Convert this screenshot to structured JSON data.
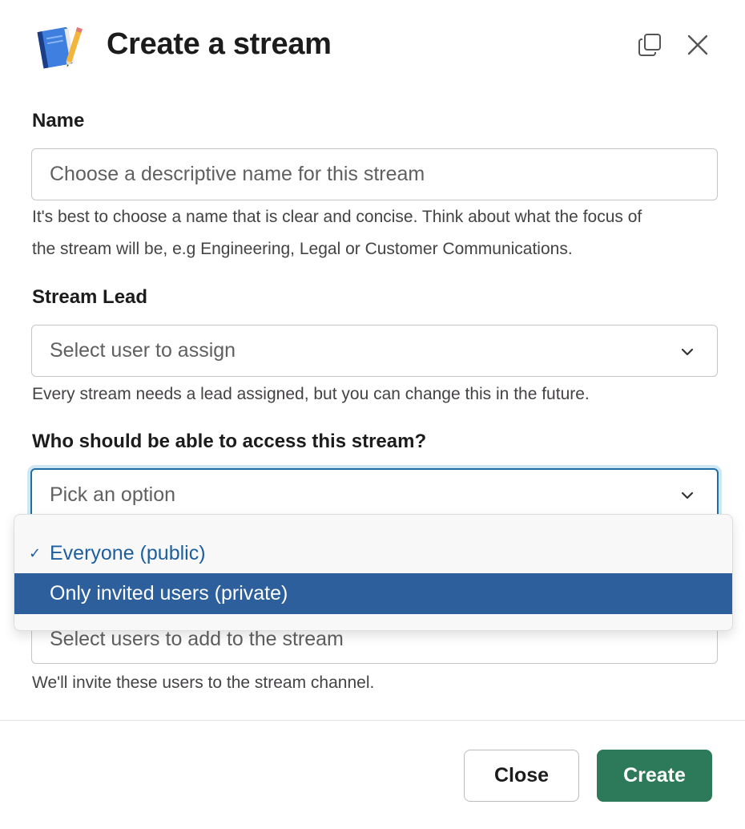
{
  "dialog": {
    "title": "Create a stream",
    "app_icon": "notebook-pencil-icon",
    "copy_icon": "copy-window-icon",
    "close_icon": "close-icon"
  },
  "name_field": {
    "label": "Name",
    "placeholder": "Choose a descriptive name for this stream",
    "value": "",
    "hint_line1": "It's best to choose a name that is clear and concise. Think about what the focus of",
    "hint_line2": "the stream will be, e.g Engineering, Legal or Customer Communications."
  },
  "lead_field": {
    "label": "Stream Lead",
    "placeholder": "Select user to assign",
    "hint": "Every stream needs a lead assigned, but you can change this in the future."
  },
  "access_field": {
    "label": "Who should be able to access this stream?",
    "placeholder": "Pick an option",
    "options": [
      {
        "label": "Everyone (public)",
        "checked": true,
        "highlighted": false
      },
      {
        "label": "Only invited users (private)",
        "checked": false,
        "highlighted": true
      }
    ],
    "check_glyph": "✓"
  },
  "invite_field": {
    "placeholder": "Select users to add to the stream",
    "hint": "We'll invite these users to the stream channel."
  },
  "footer": {
    "close_label": "Close",
    "create_label": "Create"
  },
  "colors": {
    "primary_button": "#2d7a5a",
    "highlight_option": "#2c5f9b",
    "selected_option_text": "#1d5f9e",
    "focus_ring": "#1d6fa5"
  }
}
